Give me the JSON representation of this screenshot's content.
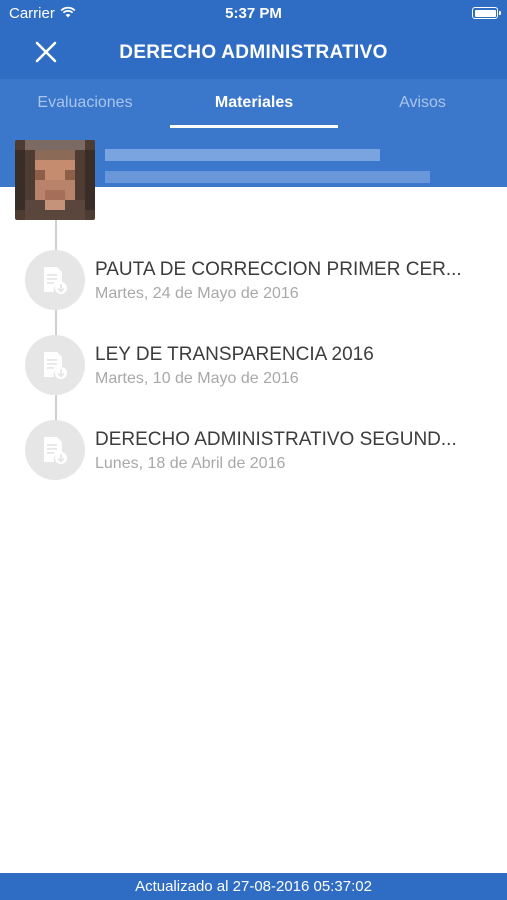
{
  "status_bar": {
    "carrier": "Carrier",
    "time": "5:37 PM"
  },
  "header": {
    "title": "DERECHO ADMINISTRATIVO",
    "close_icon": "close-icon"
  },
  "tabs": [
    {
      "label": "Evaluaciones",
      "active": false
    },
    {
      "label": "Materiales",
      "active": true
    },
    {
      "label": "Avisos",
      "active": false
    }
  ],
  "materials": [
    {
      "title": "PAUTA DE CORRECCION PRIMER CER...",
      "date": "Martes, 24 de Mayo de 2016",
      "icon": "document-download-icon"
    },
    {
      "title": "LEY DE TRANSPARENCIA 2016",
      "date": "Martes, 10 de Mayo de 2016",
      "icon": "document-download-icon"
    },
    {
      "title": "DERECHO ADMINISTRATIVO SEGUND...",
      "date": "Lunes, 18 de Abril de 2016",
      "icon": "document-download-icon"
    }
  ],
  "footer": {
    "updated": "Actualizado al 27-08-2016 05:37:02"
  },
  "colors": {
    "primary": "#2f6cc3",
    "tab_bar": "#3b77cb",
    "icon_circle": "#e6e6e6",
    "timeline": "#cfcfcf"
  }
}
